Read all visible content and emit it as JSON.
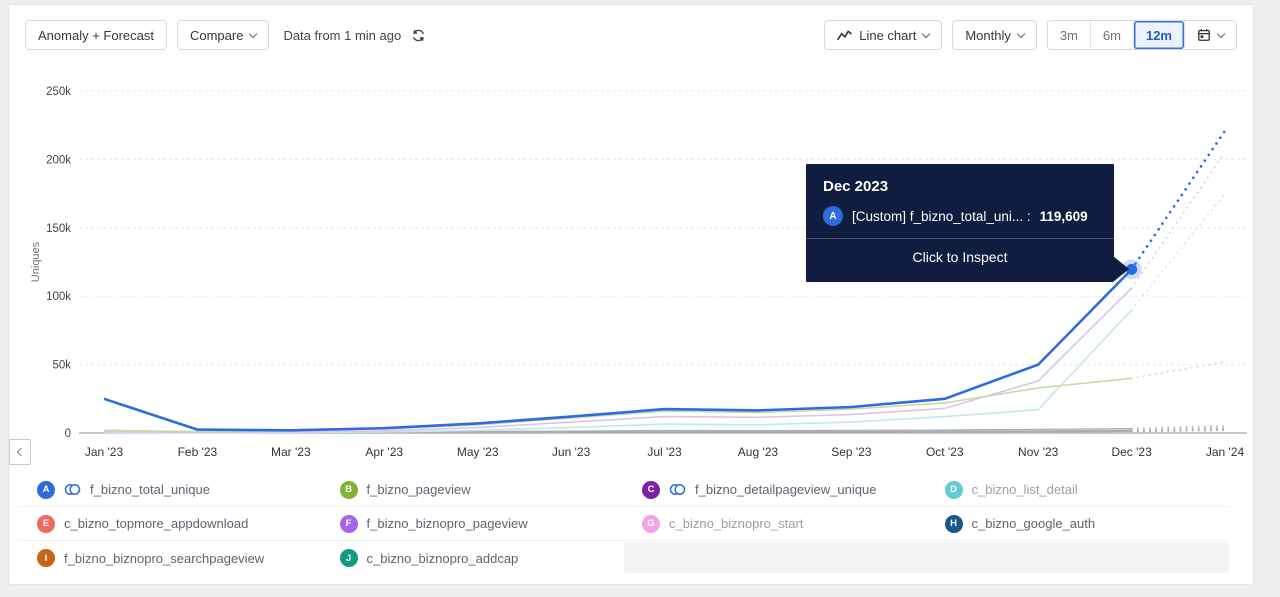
{
  "toolbar": {
    "anomaly_forecast_label": "Anomaly + Forecast",
    "compare_label": "Compare",
    "data_freshness": "Data from 1 min ago",
    "chart_type_label": "Line chart",
    "granularity_label": "Monthly",
    "range_options": [
      "3m",
      "6m",
      "12m"
    ],
    "selected_range": "12m",
    "accent_color": "#2458c6"
  },
  "tooltip": {
    "title": "Dec 2023",
    "series_badge": "A",
    "series_label": "[Custom] f_bizno_total_uni... :",
    "value": "119,609",
    "footer": "Click to Inspect",
    "bg_color": "#0f1e40"
  },
  "chart_data": {
    "type": "line",
    "ylabel": "Uniques",
    "x_labels": [
      "Jan '23",
      "Feb '23",
      "Mar '23",
      "Apr '23",
      "May '23",
      "Jun '23",
      "Jul '23",
      "Aug '23",
      "Sep '23",
      "Oct '23",
      "Nov '23",
      "Dec '23",
      "Jan '24"
    ],
    "y_tick_labels": [
      "250k",
      "200k",
      "150k",
      "100k",
      "50k",
      "0"
    ],
    "ylim": [
      0,
      250000
    ],
    "grid": true,
    "forecast_from_index": 11,
    "highlight": {
      "series_key": "A",
      "x_label": "Dec '23",
      "value": 119609,
      "value_formatted": "119,609"
    },
    "series": [
      {
        "key": "A",
        "name": "f_bizno_total_unique",
        "badge_color": "#2e6bdb",
        "line_color": "#2c6be0",
        "line_width": 2.6,
        "values": [
          25000,
          2500,
          2000,
          3500,
          7000,
          12000,
          17500,
          16500,
          19000,
          25000,
          50000,
          119609,
          221000
        ]
      },
      {
        "key": "B",
        "name": "f_bizno_pageview",
        "badge_color": "#82b336",
        "line_color": "#ccd9a4",
        "line_width": 1.6,
        "values": [
          2000,
          1000,
          1500,
          3000,
          6000,
          11000,
          16000,
          15000,
          17500,
          22000,
          33000,
          40000,
          52000
        ]
      },
      {
        "key": "C",
        "name": "f_bizno_detailpageview_unique",
        "badge_color": "#7a21a8",
        "line_color": "#dcc3ea",
        "line_width": 1.6,
        "values": [
          1000,
          500,
          800,
          1500,
          4000,
          8000,
          12000,
          11500,
          13500,
          18000,
          38000,
          106000,
          205000
        ]
      },
      {
        "key": "D",
        "name": "c_bizno_list_detail",
        "badge_color": "#62cbd4",
        "line_color": "#c1e8ee",
        "line_width": 1.6,
        "values": [
          0,
          0,
          300,
          800,
          2000,
          4000,
          6500,
          6000,
          8000,
          12000,
          17000,
          90000,
          175000
        ]
      },
      {
        "key": "E",
        "name": "c_bizno_topmore_appdownload",
        "badge_color": "#f1695e",
        "line_color": "#a9adb4",
        "line_width": 1.3,
        "values": [
          400,
          300,
          300,
          400,
          500,
          600,
          800,
          800,
          900,
          1000,
          1200,
          1600,
          3000
        ]
      },
      {
        "key": "F",
        "name": "f_bizno_biznopro_pageview",
        "badge_color": "#a763e6",
        "line_color": "#a9adb4",
        "line_width": 1.3,
        "values": [
          600,
          400,
          500,
          700,
          1000,
          1400,
          1800,
          1700,
          1900,
          2200,
          2600,
          3200,
          5000
        ]
      },
      {
        "key": "G",
        "name": "c_bizno_biznopro_start",
        "badge_color": "#f2a4e4",
        "line_color": "#a9adb4",
        "line_width": 1.3,
        "values": [
          200,
          150,
          150,
          200,
          300,
          400,
          500,
          500,
          600,
          700,
          900,
          1200,
          2200
        ]
      },
      {
        "key": "H",
        "name": "c_bizno_google_auth",
        "badge_color": "#16588f",
        "line_color": "#a9adb4",
        "line_width": 1.3,
        "values": [
          300,
          200,
          250,
          350,
          500,
          700,
          900,
          900,
          1000,
          1200,
          1500,
          2000,
          3600
        ]
      },
      {
        "key": "I",
        "name": "f_bizno_biznopro_searchpageview",
        "badge_color": "#c4661a",
        "line_color": "#a9adb4",
        "line_width": 1.3,
        "values": [
          250,
          180,
          200,
          300,
          400,
          500,
          650,
          650,
          750,
          850,
          1100,
          1500,
          2800
        ]
      },
      {
        "key": "J",
        "name": "c_bizno_biznopro_addcap",
        "badge_color": "#149c82",
        "line_color": "#a9adb4",
        "line_width": 1.3,
        "values": [
          150,
          100,
          120,
          180,
          250,
          350,
          450,
          450,
          550,
          650,
          800,
          1100,
          2000
        ]
      }
    ]
  },
  "legend": {
    "items": [
      {
        "key": "A",
        "label": "f_bizno_total_unique",
        "badge_color": "#2e6bdb",
        "formula_icon": true,
        "muted": false
      },
      {
        "key": "B",
        "label": "f_bizno_pageview",
        "badge_color": "#82b336",
        "formula_icon": false,
        "muted": false
      },
      {
        "key": "C",
        "label": "f_bizno_detailpageview_unique",
        "badge_color": "#7a21a8",
        "formula_icon": true,
        "muted": false
      },
      {
        "key": "D",
        "label": "c_bizno_list_detail",
        "badge_color": "#62cbd4",
        "formula_icon": false,
        "muted": true
      },
      {
        "key": "E",
        "label": "c_bizno_topmore_appdownload",
        "badge_color": "#f1695e",
        "formula_icon": false,
        "muted": false
      },
      {
        "key": "F",
        "label": "f_bizno_biznopro_pageview",
        "badge_color": "#a763e6",
        "formula_icon": false,
        "muted": false
      },
      {
        "key": "G",
        "label": "c_bizno_biznopro_start",
        "badge_color": "#f2a4e4",
        "formula_icon": false,
        "muted": true
      },
      {
        "key": "H",
        "label": "c_bizno_google_auth",
        "badge_color": "#16588f",
        "formula_icon": false,
        "muted": false
      },
      {
        "key": "I",
        "label": "f_bizno_biznopro_searchpageview",
        "badge_color": "#c4661a",
        "formula_icon": false,
        "muted": false
      },
      {
        "key": "J",
        "label": "c_bizno_biznopro_addcap",
        "badge_color": "#149c82",
        "formula_icon": false,
        "muted": false
      }
    ]
  }
}
